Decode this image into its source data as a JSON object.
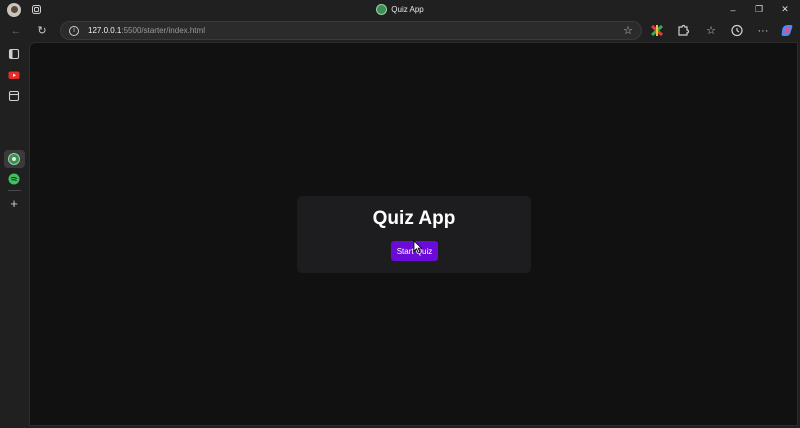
{
  "browser": {
    "tab_title": "Quiz App",
    "url_host": "127.0.0.1",
    "url_rest": ":5500/starter/index.html",
    "window_controls": {
      "minimize": "–",
      "restore": "❐",
      "close": "✕"
    },
    "toolbar": {
      "back": "←",
      "refresh": "↻",
      "favorites": "☆",
      "more": "···"
    }
  },
  "sidebar": {
    "icons": [
      "tabs-icon",
      "youtube-icon",
      "collections-icon",
      "quiz-app-icon",
      "spotify-icon",
      "add-icon"
    ],
    "add_label": "+"
  },
  "page": {
    "title": "Quiz App",
    "start_button": "Start Quiz",
    "button_color": "#6a0bd8"
  }
}
